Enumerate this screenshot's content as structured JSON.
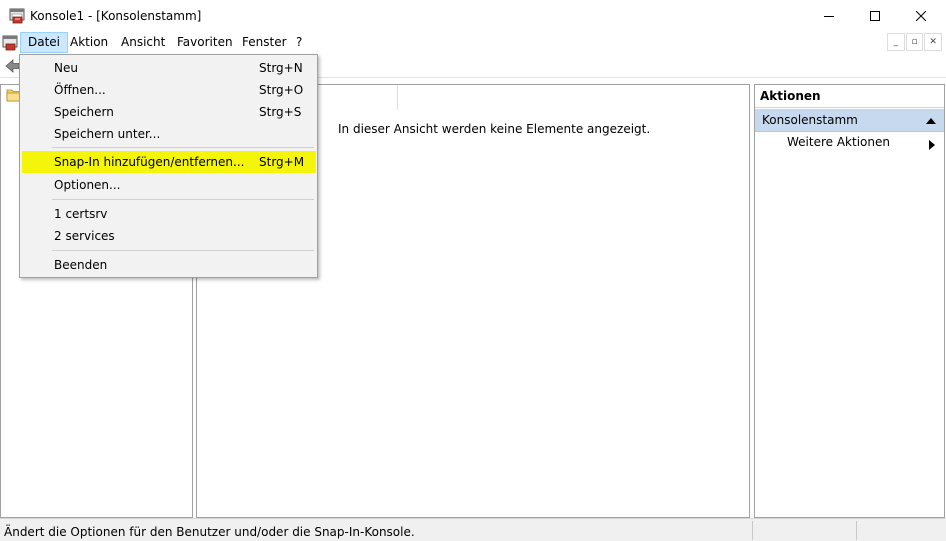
{
  "window": {
    "title": "Konsole1 - [Konsolenstamm]"
  },
  "menubar": {
    "items": [
      "Datei",
      "Aktion",
      "Ansicht",
      "Favoriten",
      "Fenster",
      "?"
    ]
  },
  "file_menu": {
    "items": [
      {
        "label": "Neu",
        "shortcut": "Strg+N"
      },
      {
        "label": "Öffnen...",
        "shortcut": "Strg+O"
      },
      {
        "label": "Speichern",
        "shortcut": "Strg+S"
      },
      {
        "label": "Speichern unter...",
        "shortcut": ""
      },
      {
        "label": "Snap-In hinzufügen/entfernen...",
        "shortcut": "Strg+M"
      },
      {
        "label": "Optionen...",
        "shortcut": ""
      },
      {
        "label": "1 certsrv",
        "shortcut": ""
      },
      {
        "label": "2 services",
        "shortcut": ""
      },
      {
        "label": "Beenden",
        "shortcut": ""
      }
    ],
    "highlight_color": "#f5f50a"
  },
  "content": {
    "empty_message": "In dieser Ansicht werden keine Elemente angezeigt."
  },
  "actions": {
    "header": "Aktionen",
    "section": "Konsolenstamm",
    "items": [
      "Weitere Aktionen"
    ]
  },
  "statusbar": {
    "text": "Ändert die Optionen für den Benutzer und/oder die Snap-In-Konsole."
  },
  "colors": {
    "menu_active_bg": "#cce8ff",
    "section_bg": "#c6d9ef"
  },
  "icons": {
    "app": "mmc-console-icon",
    "back": "back-arrow-icon",
    "tree_root": "folder-icon"
  }
}
